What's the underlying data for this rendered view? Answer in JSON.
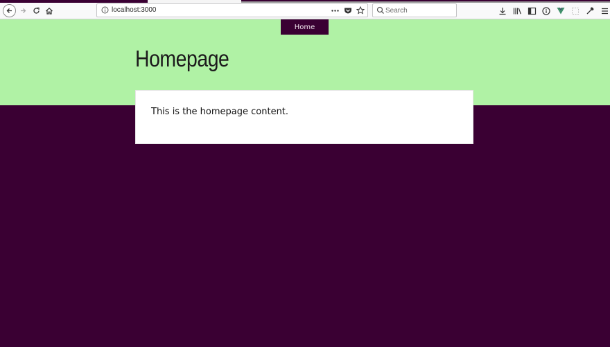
{
  "browser": {
    "url": "localhost:3000",
    "search_placeholder": "Search",
    "icons": {
      "back": "back-arrow-icon",
      "forward": "forward-arrow-icon",
      "reload": "reload-icon",
      "home": "home-icon",
      "page_actions": "more-horizontal-icon",
      "pocket": "pocket-icon",
      "bookmark": "star-icon",
      "downloads": "download-icon",
      "library": "library-icon",
      "sidebar": "sidebar-icon",
      "reader": "info-circle-icon",
      "vue_devtools": "vue-logo-icon",
      "screenshot": "screenshot-icon",
      "eyedropper": "eyedropper-icon",
      "menu": "hamburger-menu-icon"
    }
  },
  "page": {
    "nav_items": [
      {
        "label": "Home"
      }
    ],
    "title": "Homepage",
    "content": "This is the homepage content."
  },
  "colors": {
    "header_bg": "#b0f2a5",
    "body_bg": "#3a0033",
    "nav_bg": "#3a0033"
  }
}
